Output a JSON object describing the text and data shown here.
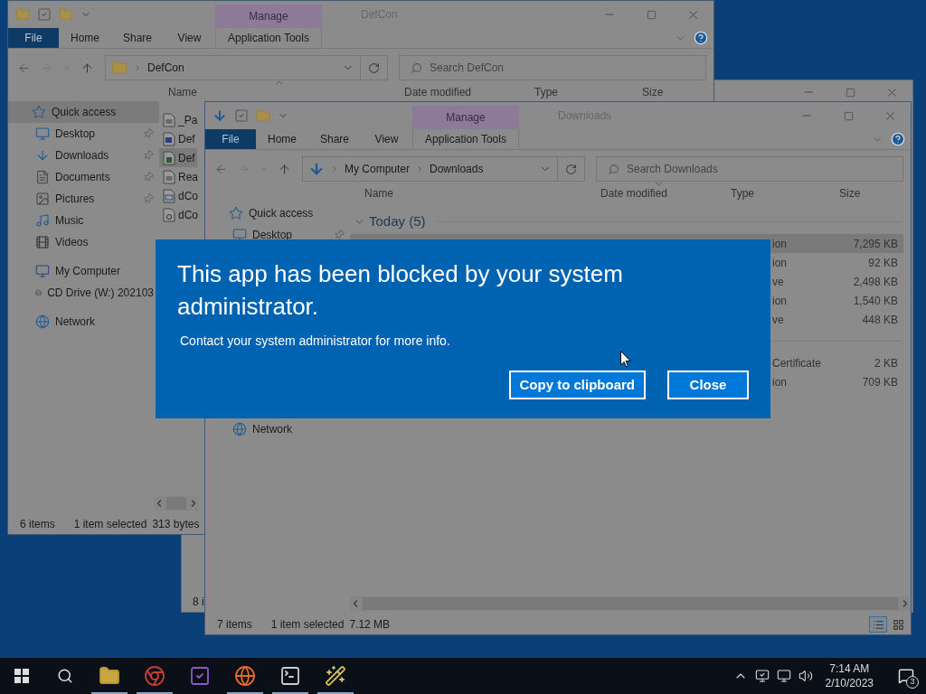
{
  "background_window": {
    "status": [
      "8 i"
    ]
  },
  "windows": [
    {
      "title": "DefCon",
      "context_tab": "Manage",
      "ribbon_tabs": [
        {
          "label": "File",
          "selected": true
        },
        {
          "label": "Home",
          "selected": false
        },
        {
          "label": "Share",
          "selected": false
        },
        {
          "label": "View",
          "selected": false
        },
        {
          "label": "Application Tools",
          "selected": false
        }
      ],
      "address": [
        "DefCon"
      ],
      "search": {
        "placeholder": "Search DefCon"
      },
      "columns": [
        "Name",
        "Date modified",
        "Type",
        "Size"
      ],
      "nav_groups": [
        {
          "items": [
            {
              "label": "Quick access",
              "selected": true,
              "pinned": false
            },
            {
              "label": "Desktop",
              "selected": false,
              "pinned": true
            },
            {
              "label": "Downloads",
              "selected": false,
              "pinned": true
            },
            {
              "label": "Documents",
              "selected": false,
              "pinned": true
            },
            {
              "label": "Pictures",
              "selected": false,
              "pinned": true
            },
            {
              "label": "Music",
              "selected": false,
              "pinned": false
            },
            {
              "label": "Videos",
              "selected": false,
              "pinned": false
            }
          ]
        },
        {
          "items": [
            {
              "label": "My Computer",
              "selected": false,
              "pinned": false
            },
            {
              "label": "CD Drive (W:) 202103",
              "selected": false,
              "pinned": false
            }
          ]
        },
        {
          "items": [
            {
              "label": "Network",
              "selected": false,
              "pinned": false
            }
          ]
        }
      ],
      "files": [
        {
          "name": "_Pa",
          "selected": false
        },
        {
          "name": "Def",
          "selected": false
        },
        {
          "name": "Def",
          "selected": true
        },
        {
          "name": "Rea",
          "selected": false
        },
        {
          "name": "dCo",
          "selected": false
        },
        {
          "name": "dCo",
          "selected": false
        }
      ],
      "status": [
        "6 items",
        "1 item selected",
        "313 bytes"
      ]
    },
    {
      "title": "Downloads",
      "context_tab": "Manage",
      "ribbon_tabs": [
        {
          "label": "File",
          "selected": true
        },
        {
          "label": "Home",
          "selected": false
        },
        {
          "label": "Share",
          "selected": false
        },
        {
          "label": "View",
          "selected": false
        },
        {
          "label": "Application Tools",
          "selected": false
        }
      ],
      "address": [
        "My Computer",
        "Downloads"
      ],
      "search": {
        "placeholder": "Search Downloads"
      },
      "columns": [
        "Name",
        "Date modified",
        "Type",
        "Size"
      ],
      "nav_groups": [
        {
          "items": [
            {
              "label": "Quick access",
              "selected": false,
              "pinned": false
            },
            {
              "label": "Desktop",
              "selected": false,
              "pinned": true
            }
          ]
        },
        {
          "items": [
            {
              "label": "Network",
              "selected": false,
              "pinned": false
            }
          ]
        }
      ],
      "file_groups": [
        {
          "label": "Today (5)",
          "expanded": true,
          "files": [
            {
              "type": "ion",
              "size": "7,295 KB",
              "selected": true
            },
            {
              "type": "ion",
              "size": "92 KB",
              "selected": false
            },
            {
              "type": "ve",
              "size": "2,498 KB",
              "selected": false
            },
            {
              "type": "ion",
              "size": "1,540 KB",
              "selected": false
            },
            {
              "type": "ve",
              "size": "448 KB",
              "selected": false
            }
          ]
        },
        {
          "files": [
            {
              "type": "Certificate",
              "size": "2 KB",
              "selected": false
            },
            {
              "type": "ion",
              "size": "709 KB",
              "selected": false
            }
          ]
        }
      ],
      "status": [
        "7 items",
        "1 item selected",
        "7.12 MB"
      ],
      "view_buttons": [
        {
          "selected": true
        },
        {
          "selected": false
        }
      ]
    }
  ],
  "dialog": {
    "title": "This app has been blocked by your system administrator.",
    "message": "Contact your system administrator for more info.",
    "buttons": [
      {
        "label": "Copy to clipboard"
      },
      {
        "label": "Close"
      }
    ]
  },
  "taskbar": {
    "apps": [
      {
        "running": true
      },
      {
        "running": true
      },
      {
        "running": false
      },
      {
        "running": true
      },
      {
        "running": true
      },
      {
        "running": true
      }
    ],
    "time": "7:14 AM",
    "date": "2/10/2023",
    "notifications": "3"
  }
}
